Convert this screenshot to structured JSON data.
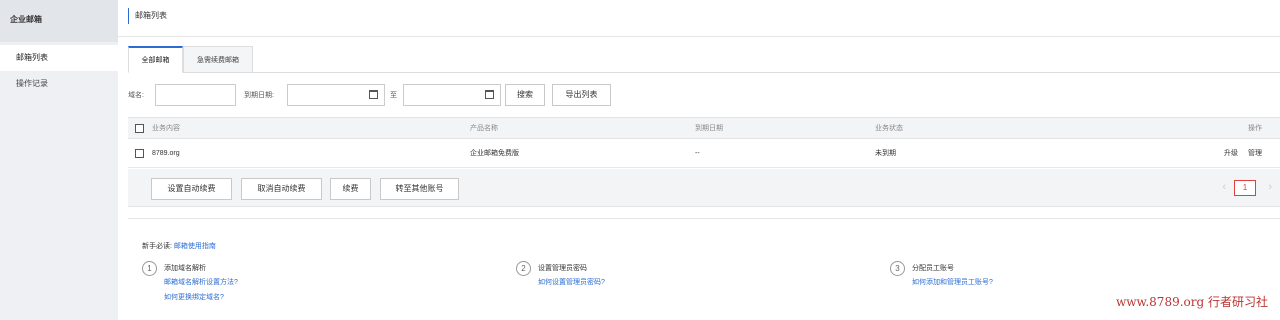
{
  "sidebar": {
    "title": "企业邮箱",
    "items": [
      {
        "label": "邮箱列表",
        "active": true
      },
      {
        "label": "操作记录",
        "active": false
      }
    ]
  },
  "header": {
    "title": "邮箱列表"
  },
  "tabs": [
    {
      "label": "全部邮箱",
      "active": true
    },
    {
      "label": "急需续费邮箱",
      "active": false
    }
  ],
  "filters": {
    "domain_label": "域名:",
    "domain_value": "",
    "expire_label": "到期日期:",
    "start_date": "",
    "to_label": "至",
    "end_date": "",
    "search_label": "搜索",
    "export_label": "导出列表"
  },
  "table": {
    "columns": [
      "业务内容",
      "产品名称",
      "到期日期",
      "业务状态",
      "操作"
    ],
    "rows": [
      {
        "content": "8789.org",
        "product": "企业邮箱免费版",
        "expire": "--",
        "status": "未到期",
        "actions": [
          "升级",
          "管理"
        ]
      }
    ]
  },
  "bulk_actions": [
    "设置自动续费",
    "取消自动续费",
    "续费",
    "转至其他账号"
  ],
  "pagination": {
    "current": "1",
    "prev": "‹",
    "next": "›"
  },
  "guide": {
    "prefix": "新手必读:",
    "link": "邮箱使用指南",
    "steps": [
      {
        "num": "1",
        "title": "添加域名解析",
        "links": [
          "邮箱域名解析设置方法?",
          "如何更换绑定域名?"
        ]
      },
      {
        "num": "2",
        "title": "设置管理员密码",
        "links": [
          "如何设置管理员密码?"
        ]
      },
      {
        "num": "3",
        "title": "分配员工账号",
        "links": [
          "如何添加和管理员工账号?"
        ]
      }
    ]
  },
  "watermark": "www.8789.org 行者研习社",
  "colors": {
    "accent": "#2b6cd3",
    "pager": "#e04040",
    "sidebar_bg": "#eef0f3",
    "watermark": "#bb3333"
  }
}
